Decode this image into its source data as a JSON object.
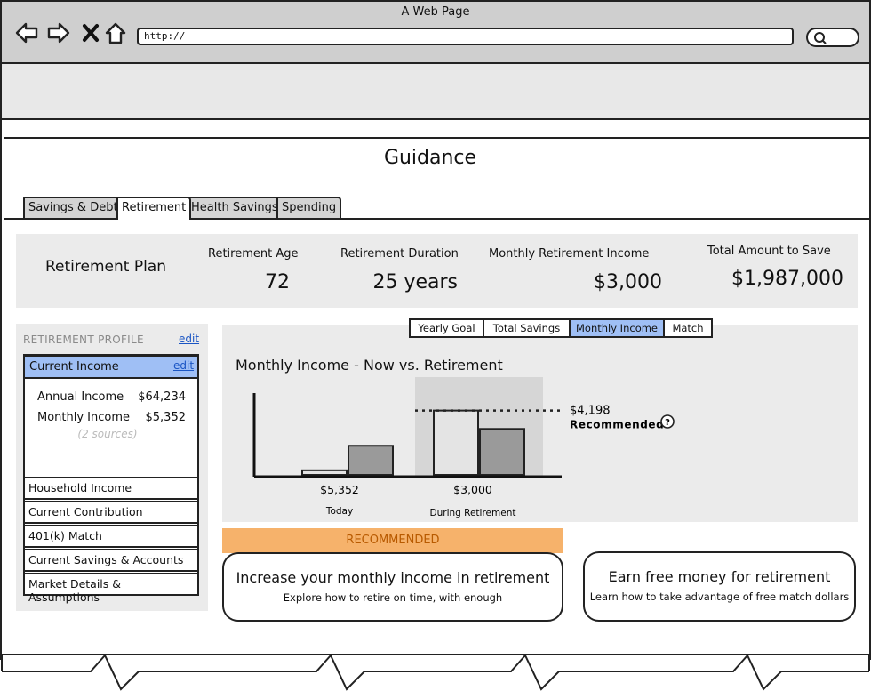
{
  "browser": {
    "title": "A Web Page",
    "url": "http://"
  },
  "page": {
    "title": "Guidance"
  },
  "tabs": [
    {
      "label": "Savings & Debt",
      "active": false
    },
    {
      "label": "Retirement",
      "active": true
    },
    {
      "label": "Health Savings",
      "active": false
    },
    {
      "label": "Spending",
      "active": false
    }
  ],
  "summary": {
    "plan_title": "Retirement Plan",
    "items": [
      {
        "label": "Retirement Age",
        "value": "72"
      },
      {
        "label": "Retirement Duration",
        "value": "25 years"
      },
      {
        "label": "Monthly Retirement Income",
        "value": "$3,000"
      },
      {
        "label": "Total Amount to Save",
        "value": "$1,987,000"
      }
    ]
  },
  "profile": {
    "title": "RETIREMENT PROFILE",
    "edit_label": "edit",
    "current_income": {
      "label": "Current Income",
      "edit_label": "edit",
      "rows": [
        {
          "label": "Annual Income",
          "value": "$64,234"
        },
        {
          "label": "Monthly Income",
          "value": "$5,352"
        }
      ],
      "sources_note": "(2 sources)"
    },
    "items": [
      "Household Income",
      "Current Contribution",
      "401(k) Match",
      "Current Savings & Accounts",
      "Market Details & Assumptions"
    ]
  },
  "chart_view": {
    "options": [
      "Yearly Goal",
      "Total Savings",
      "Monthly Income",
      "Match"
    ],
    "selected": "Monthly Income"
  },
  "chart_data": {
    "type": "bar",
    "title": "Monthly Income - Now vs. Retirement",
    "categories": [
      "Today",
      "During Retirement"
    ],
    "category_values": [
      "$5,352",
      "$3,000"
    ],
    "series": [
      {
        "values": [
          300,
          4198
        ],
        "color": "#e4e4e4"
      },
      {
        "values": [
          1900,
          3000
        ],
        "color": "#9a9a9a"
      }
    ],
    "reference_line": {
      "value": 4198,
      "label": "$4,198",
      "note": "Recommended"
    },
    "ylim": [
      0,
      5800
    ],
    "grid": false
  },
  "recommended": {
    "label": "RECOMMENDED",
    "cards": [
      {
        "title": "Increase your monthly income in retirement",
        "subtitle": "Explore how to retire on time, with enough"
      },
      {
        "title": "Earn free money for retirement",
        "subtitle": "Learn how to take advantage of free match dollars"
      }
    ]
  },
  "colors": {
    "accent_blue": "#9fbff5",
    "recommended_orange": "#f6b26b",
    "link_blue": "#1a55c4"
  },
  "icons": [
    "back-arrow-icon",
    "forward-arrow-icon",
    "close-icon",
    "home-icon",
    "search-icon",
    "help-icon"
  ]
}
